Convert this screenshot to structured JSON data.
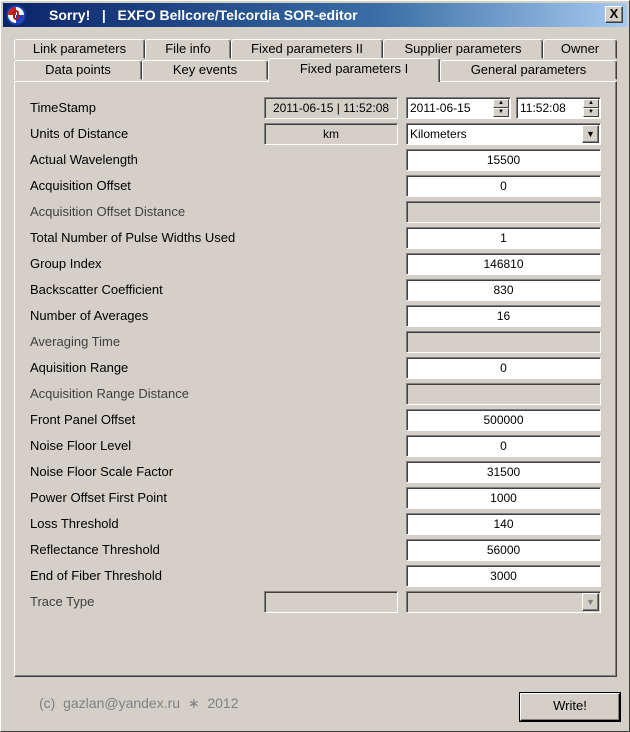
{
  "window": {
    "title": "Sorry!   |   EXFO Bellcore/Telcordia SOR-editor",
    "close_glyph": "X"
  },
  "tabs_back_row": [
    {
      "label": "Link parameters"
    },
    {
      "label": "File info"
    },
    {
      "label": "Fixed parameters II"
    },
    {
      "label": "Supplier parameters"
    },
    {
      "label": "Owner"
    }
  ],
  "tabs_front_row": [
    {
      "label": "Data points"
    },
    {
      "label": "Key events"
    },
    {
      "label": "Fixed parameters I",
      "active": true
    },
    {
      "label": "General parameters"
    }
  ],
  "timestamp": {
    "label": "TimeStamp",
    "raw": "2011-06-15  |  11:52:08",
    "date": "2011-06-15",
    "time": "11:52:08"
  },
  "units": {
    "label": "Units of Distance",
    "raw": "km",
    "selected": "Kilometers"
  },
  "fields": [
    {
      "label": "Actual Wavelength",
      "value": "15500"
    },
    {
      "label": "Acquisition Offset",
      "value": "0"
    },
    {
      "label": "Acquisition Offset Distance",
      "value": ""
    },
    {
      "label": "Total Number of Pulse Widths Used",
      "value": "1"
    },
    {
      "label": "Group Index",
      "value": "146810"
    },
    {
      "label": "Backscatter Coefficient",
      "value": "830"
    },
    {
      "label": "Number of Averages",
      "value": "16"
    },
    {
      "label": "Averaging Time",
      "value": ""
    },
    {
      "label": "Aquisition Range",
      "value": "0"
    },
    {
      "label": "Acquisition Range Distance",
      "value": ""
    },
    {
      "label": "Front Panel Offset",
      "value": "500000"
    },
    {
      "label": "Noise Floor Level",
      "value": "0"
    },
    {
      "label": "Noise Floor Scale Factor",
      "value": "31500"
    },
    {
      "label": "Power Offset First Point",
      "value": "1000"
    },
    {
      "label": "Loss Threshold",
      "value": "140"
    },
    {
      "label": "Reflectance Threshold",
      "value": "56000"
    },
    {
      "label": "End of Fiber Threshold",
      "value": "3000"
    }
  ],
  "trace_type": {
    "label": "Trace Type",
    "raw": "",
    "selected": ""
  },
  "footer": {
    "copyright": "(c)  gazlan@yandex.ru  ∗  2012",
    "write_label": "Write!"
  },
  "icons": {
    "spin_up": "▲",
    "spin_down": "▼",
    "combo_arrow": "▼"
  }
}
